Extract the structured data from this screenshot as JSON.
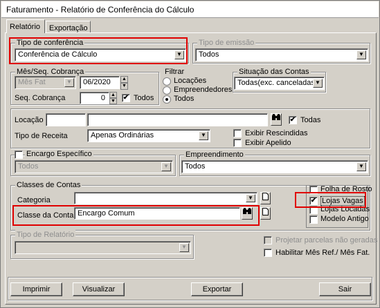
{
  "window": {
    "title": "Faturamento - Relatório de Conferência do Cálculo"
  },
  "tabs": [
    {
      "label": "Relatório"
    },
    {
      "label": "Exportação"
    }
  ],
  "tipo_conferencia": {
    "legend": "Tipo de conferência",
    "value": "Conferência de Cálculo"
  },
  "tipo_emissao": {
    "legend": "Tipo de emissão",
    "value": "Todos"
  },
  "mes_seq": {
    "legend": "Mês/Seq. Cobrança",
    "mes_fat_value": "Mês Fat",
    "date_value": "06/2020",
    "seq_label": "Seq. Cobrança",
    "seq_value": "0",
    "todos_label": "Todos",
    "todos_checked": true
  },
  "filtrar": {
    "legend": "Filtrar",
    "options": [
      "Locações",
      "Empreendedores",
      "Todos"
    ],
    "selected": "Todos"
  },
  "situacao": {
    "legend": "Situação das Contas",
    "value": "Todas(exc. canceladas"
  },
  "locacao": {
    "label": "Locação",
    "todas_label": "Todas",
    "todas_checked": true,
    "tipo_receita_label": "Tipo de Receita",
    "tipo_receita_value": "Apenas Ordinárias",
    "exibir_rescindidas": "Exibir Rescindidas",
    "exibir_apelido": "Exibir Apelido"
  },
  "encargo": {
    "label": "Encargo Específico",
    "value": "Todos"
  },
  "empreendimento": {
    "legend": "Empreendimento",
    "value": "Todos"
  },
  "classes": {
    "legend": "Classes de Contas",
    "categoria_label": "Categoria",
    "classe_label": "Classe da Conta",
    "classe_value": "Encargo Comum"
  },
  "options": {
    "folha_resto": "Folha de Rosto",
    "lojas_vagas": "Lojas Vagas",
    "lojas_locadas": "Lojas Locadas",
    "modelo_antigo": "Modelo Antigo"
  },
  "tipo_relatorio": {
    "legend": "Tipo de Relatório"
  },
  "projetar": "Projetar parcelas não geradas",
  "habilitar": "Habilitar Mês Ref./ Mês Fat.",
  "buttons": {
    "imprimir": "Imprimir",
    "visualizar": "Visualizar",
    "exportar": "Exportar",
    "sair": "Sair"
  },
  "colors": {
    "highlight": "#e00000",
    "face": "#d4d0c8"
  }
}
